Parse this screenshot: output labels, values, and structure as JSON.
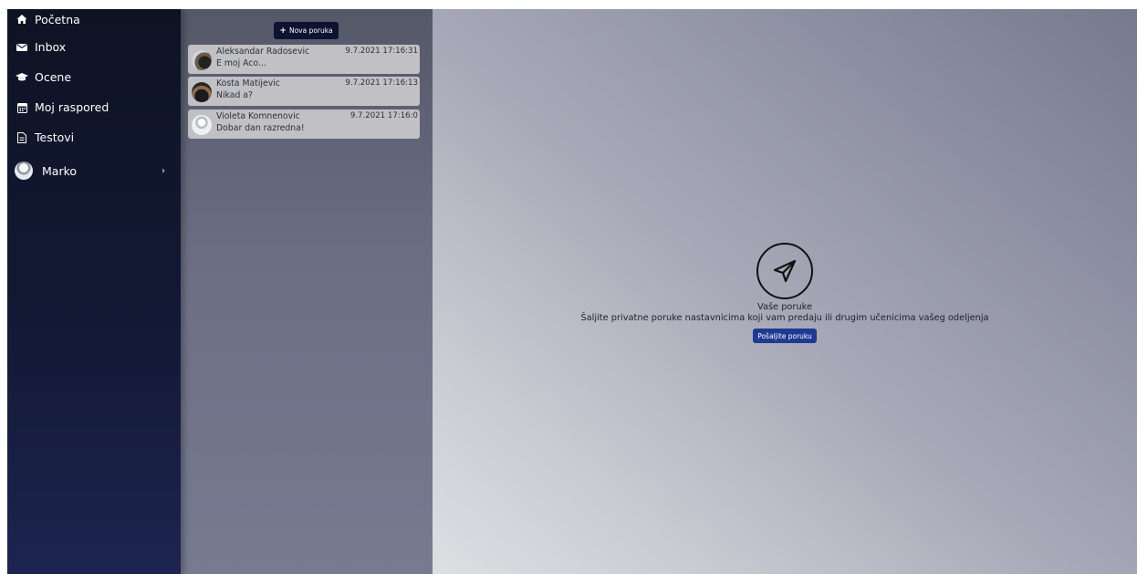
{
  "sidebar": {
    "items": [
      {
        "label": "Početna",
        "icon": "home-icon"
      },
      {
        "label": "Inbox",
        "icon": "envelope-icon"
      },
      {
        "label": "Ocene",
        "icon": "graduation-cap-icon"
      },
      {
        "label": "Moj raspored",
        "icon": "calendar-icon"
      },
      {
        "label": "Testovi",
        "icon": "document-icon"
      }
    ],
    "user": {
      "name": "Marko",
      "chevron": "›"
    }
  },
  "messages": {
    "new_button_label": "Nova poruka",
    "items": [
      {
        "name": "Aleksandar Radosevic",
        "time": "9.7.2021 17:16:31",
        "preview": "E moj Aco..."
      },
      {
        "name": "Kosta Matijevic",
        "time": "9.7.2021 17:16:13",
        "preview": "Nikad a?"
      },
      {
        "name": "Violeta Komnenovic",
        "time": "9.7.2021 17:16:0",
        "preview": "Dobar dan razredna!"
      }
    ]
  },
  "main": {
    "title": "Vaše poruke",
    "subtitle": "Šaljite privatne poruke nastavnicima koji vam predaju ili drugim učenicima vašeg odeljenja",
    "send_button_label": "Pošaljite poruku"
  },
  "colors": {
    "sidebar_bg": "#121934",
    "list_bg": "#6c6f84",
    "primary_button": "#1f3a93",
    "new_button": "#0e1332"
  }
}
